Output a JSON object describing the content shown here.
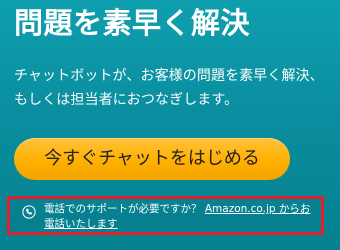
{
  "hero": {
    "title": "問題を素早く解決",
    "description": "チャットボットが、お客様の問題を素早く解決、もしくは担当者におつなぎします。",
    "cta_label": "今すぐチャットをはじめる"
  },
  "support": {
    "prompt_text": "電話でのサポートが必要ですか？ ",
    "link_text": "Amazon.co.jp からお電話いたします",
    "icon": "phone-icon"
  },
  "colors": {
    "background_teal": "#0a8e9f",
    "button_amber": "#ffb000",
    "highlight_red": "#e0212b"
  }
}
